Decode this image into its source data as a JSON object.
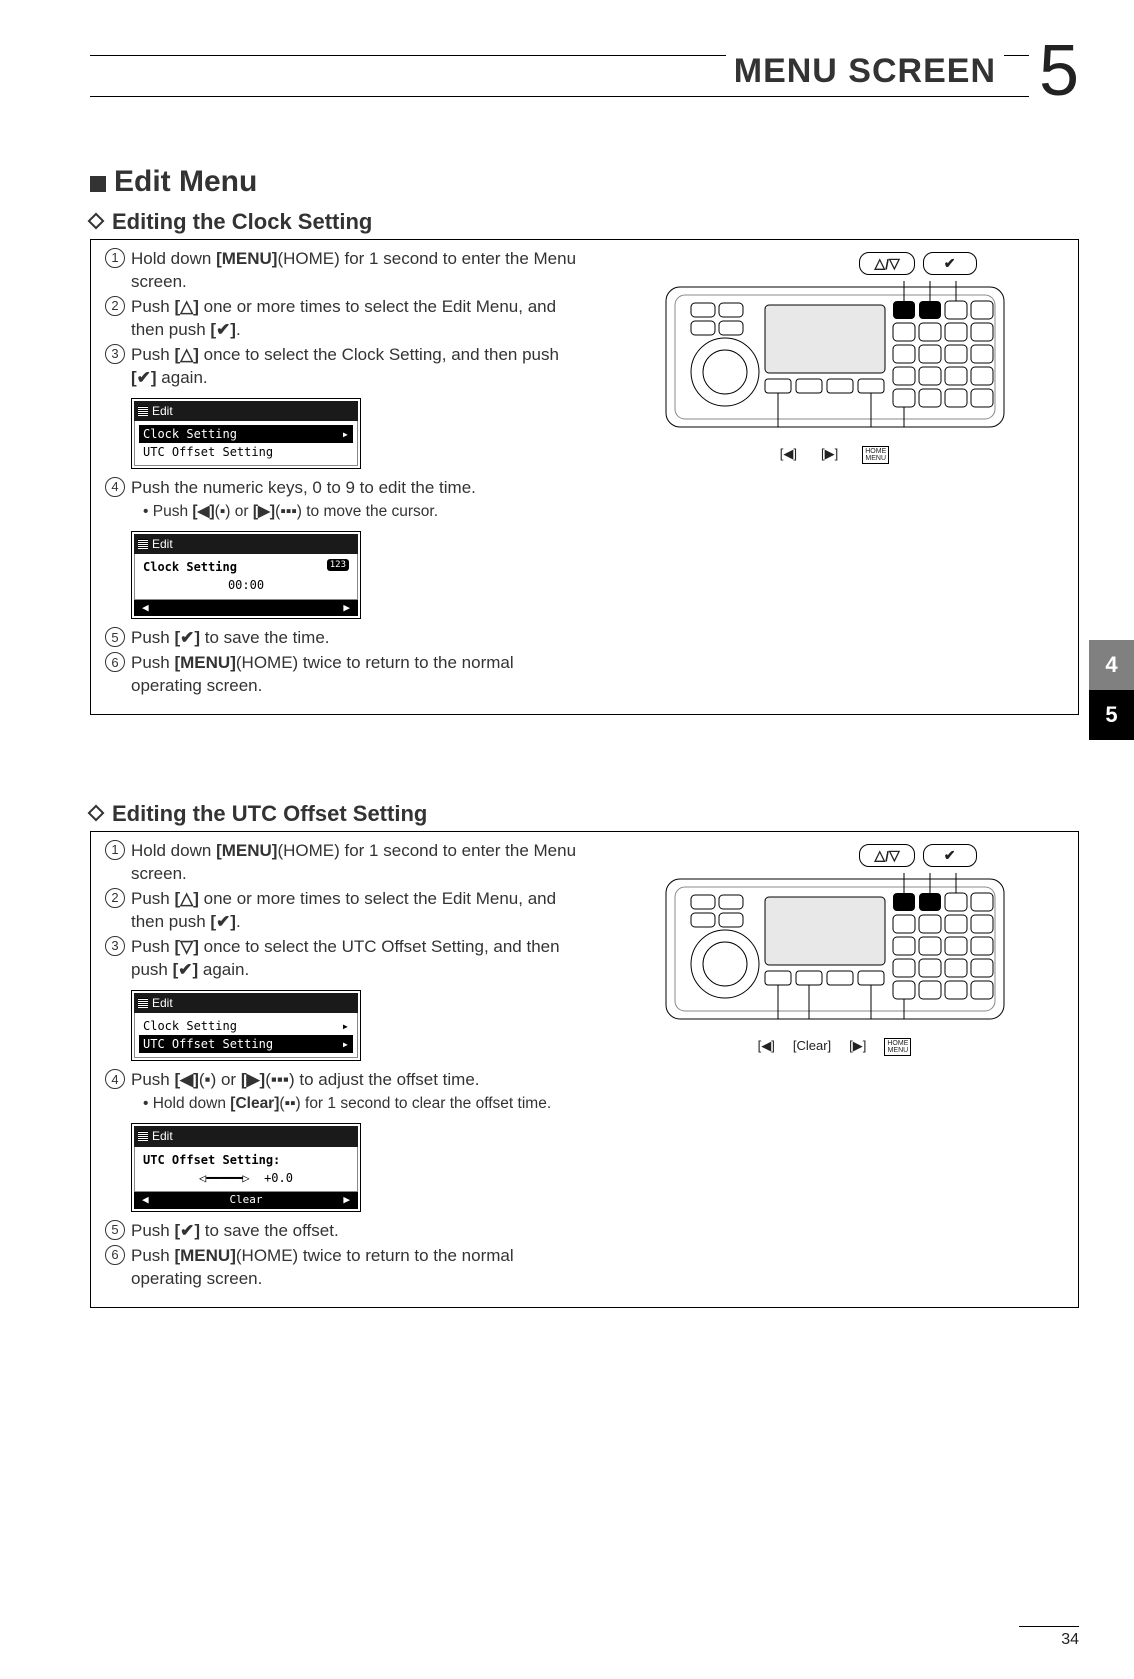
{
  "page": {
    "number": "34",
    "chapter_number": "5",
    "header": "MENU SCREEN"
  },
  "side_tabs": [
    "4",
    "5"
  ],
  "main_heading": "Edit Menu",
  "sections": [
    {
      "title": "Editing the Clock Setting",
      "steps": [
        {
          "n": "1",
          "pre": "Hold down ",
          "bold": "[MENU]",
          "post": "(HOME) for 1 second to enter the Menu screen."
        },
        {
          "n": "2",
          "pre": "Push ",
          "bold": "[△]",
          "post": " one or more times to select the Edit Menu, and then push ",
          "bold2": "[✔]",
          "post2": "."
        },
        {
          "n": "3",
          "pre": "Push ",
          "bold": "[△]",
          "post": " once to select the Clock Setting, and then push ",
          "bold2": "[✔]",
          "post2": " again."
        },
        {
          "n": "4",
          "pre": "Push the numeric keys, 0 to 9 to edit the time.",
          "bold": "",
          "post": ""
        },
        {
          "n": "5",
          "pre": "Push ",
          "bold": "[✔]",
          "post": " to save the time."
        },
        {
          "n": "6",
          "pre": "Push ",
          "bold": "[MENU]",
          "post": "(HOME) twice to return to the normal operating screen."
        }
      ],
      "sub4": {
        "pre": "Push ",
        "b1": "[◀]",
        "m1": "(▪) or ",
        "b2": "[▶]",
        "post": "(▪▪▪) to move the cursor."
      },
      "lcd1": {
        "title": "Edit",
        "row_sel": "Clock Setting",
        "row2": "UTC Offset Setting"
      },
      "lcd2": {
        "title": "Edit",
        "heading": "Clock Setting",
        "badge": "123",
        "value": "00:00",
        "soft_l": "◀",
        "soft_r": "▶"
      },
      "key_labels": {
        "l": "[◀]",
        "r": "[▶]",
        "menu": "HOME\nMENU"
      },
      "top_btns": {
        "updown": "△ / ▽",
        "ok": "✔"
      }
    },
    {
      "title": "Editing the UTC Offset Setting",
      "steps": [
        {
          "n": "1",
          "pre": "Hold down ",
          "bold": "[MENU]",
          "post": "(HOME) for 1 second to enter the Menu screen."
        },
        {
          "n": "2",
          "pre": "Push ",
          "bold": "[△]",
          "post": " one or more times to select the Edit Menu, and then push ",
          "bold2": "[✔]",
          "post2": "."
        },
        {
          "n": "3",
          "pre": "Push ",
          "bold": "[▽]",
          "post": " once to select the UTC Offset Setting, and then push ",
          "bold2": "[✔]",
          "post2": " again."
        },
        {
          "n": "4",
          "pre": "Push ",
          "bold": "[◀]",
          "post": "(▪) or ",
          "bold2": "[▶]",
          "post2": "(▪▪▪) to adjust the offset time."
        },
        {
          "n": "5",
          "pre": "Push ",
          "bold": "[✔]",
          "post": " to save the offset."
        },
        {
          "n": "6",
          "pre": "Push ",
          "bold": "[MENU]",
          "post": "(HOME) twice to return to the normal operating screen."
        }
      ],
      "sub4": {
        "pre": "Hold down ",
        "b1": "[Clear]",
        "m1": "(▪▪) for 1 second to clear the offset time.",
        "b2": "",
        "post": ""
      },
      "lcd1": {
        "title": "Edit",
        "row1": "Clock Setting",
        "row_sel": "UTC Offset Setting"
      },
      "lcd2": {
        "title": "Edit",
        "heading": "UTC Offset Setting:",
        "value": "+0.0",
        "soft_l": "◀",
        "soft_m": "Clear",
        "soft_r": "▶"
      },
      "key_labels": {
        "l": "[◀]",
        "clear": "[Clear]",
        "r": "[▶]",
        "menu": "HOME\nMENU"
      },
      "top_btns": {
        "updown": "△ / ▽",
        "ok": "✔"
      }
    }
  ]
}
